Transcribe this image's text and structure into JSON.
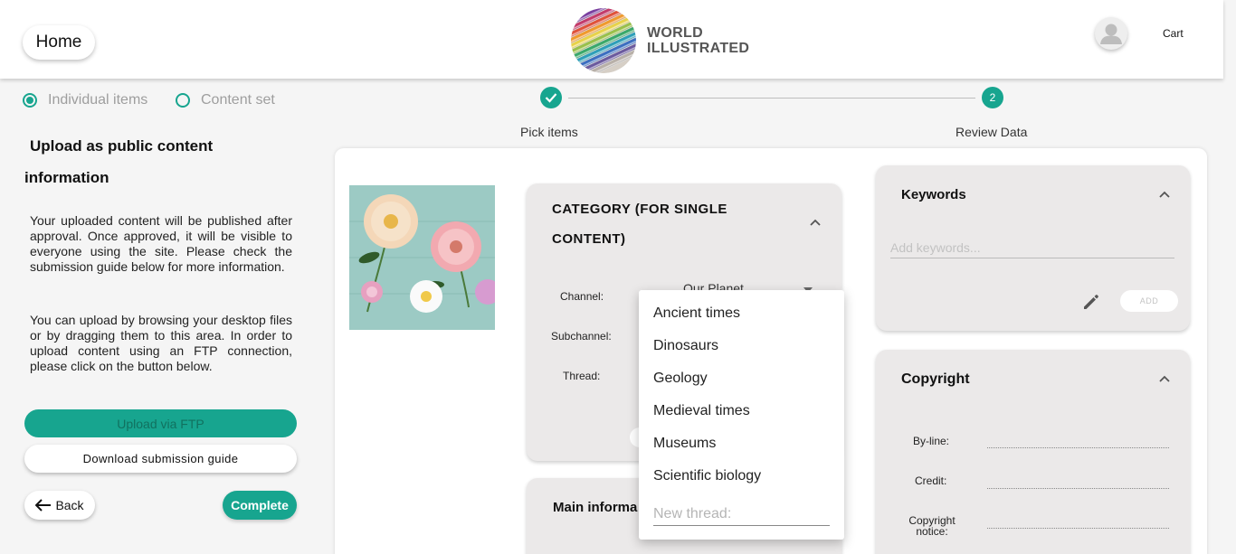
{
  "header": {
    "home_label": "Home",
    "brand_line1": "WORLD",
    "brand_line2": "ILLUSTRATED",
    "cart_label": "Cart"
  },
  "upload_mode": {
    "options": [
      "Individual items",
      "Content set"
    ],
    "selected": "Individual items"
  },
  "left": {
    "title_line1": "Upload as public content",
    "title_line2": "information",
    "paragraph1": "Your uploaded content will be published after approval. Once approved, it will be visible to everyone using the site. Please check the submission guide below for more information.",
    "paragraph2": "You can upload by browsing your desktop files or by dragging them to this area. In order to upload content using an FTP connection, please click on the button below.",
    "ftp_button": "Upload via FTP",
    "guide_button": "Download submission guide",
    "back_button": "Back",
    "complete_button": "Complete"
  },
  "stepper": {
    "steps": [
      {
        "label": "Pick items",
        "state": "done"
      },
      {
        "label": "Review Data",
        "number": "2",
        "state": "active"
      }
    ],
    "accent": "#17a58f"
  },
  "category": {
    "title": "CATEGORY (FOR SINGLE CONTENT)",
    "channel_label": "Channel:",
    "channel_value": "Our Planet",
    "subchannel_label": "Subchannel:",
    "thread_label": "Thread:"
  },
  "thread_dropdown": {
    "options": [
      "Ancient times",
      "Dinosaurs",
      "Geology",
      "Medieval times",
      "Museums",
      "Scientific biology"
    ],
    "new_thread_placeholder": "New thread:"
  },
  "main_info": {
    "title": "Main informa"
  },
  "keywords": {
    "title": "Keywords",
    "placeholder": "Add keywords...",
    "add_label": "ADD"
  },
  "copyright": {
    "title": "Copyright",
    "byline_label": "By-line:",
    "credit_label": "Credit:",
    "notice_label_line1": "Copyright",
    "notice_label_line2": "notice:"
  }
}
